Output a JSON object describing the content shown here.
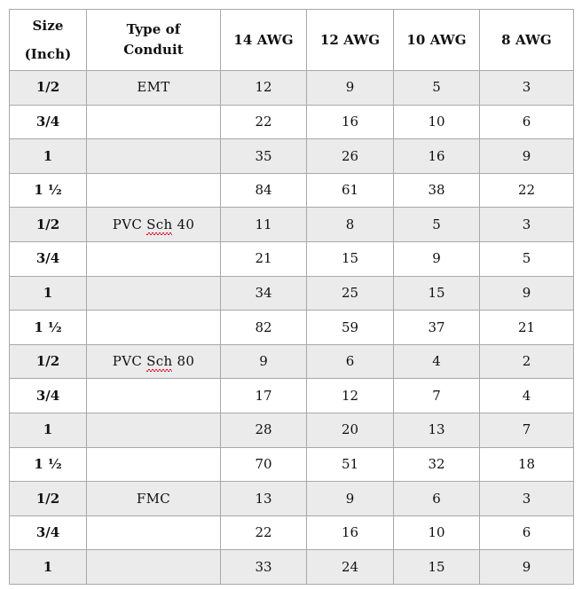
{
  "table": {
    "headers": [
      {
        "lines": [
          "Size",
          "(Inch)"
        ]
      },
      {
        "lines": [
          "Type of",
          "Conduit"
        ]
      },
      {
        "lines": [
          "14 AWG"
        ]
      },
      {
        "lines": [
          "12 AWG"
        ]
      },
      {
        "lines": [
          "10 AWG"
        ]
      },
      {
        "lines": [
          "8 AWG"
        ]
      }
    ],
    "header_labels": {
      "size": "Size",
      "size_unit": "(Inch)",
      "type_line1": "Type of",
      "type_line2": "Conduit",
      "awg14": "14 AWG",
      "awg12": "12 AWG",
      "awg10": "10 AWG",
      "awg8": "8 AWG"
    },
    "rows": [
      {
        "size": "1/2",
        "type": "EMT",
        "type_misspelled": "",
        "type_suffix": "",
        "awg14": "12",
        "awg12": "9",
        "awg10": "5",
        "awg8": "3",
        "shaded": true
      },
      {
        "size": "3/4",
        "type": "",
        "type_misspelled": "",
        "type_suffix": "",
        "awg14": "22",
        "awg12": "16",
        "awg10": "10",
        "awg8": "6",
        "shaded": false
      },
      {
        "size": "1",
        "type": "",
        "type_misspelled": "",
        "type_suffix": "",
        "awg14": "35",
        "awg12": "26",
        "awg10": "16",
        "awg8": "9",
        "shaded": true
      },
      {
        "size": "1 ½",
        "type": "",
        "type_misspelled": "",
        "type_suffix": "",
        "awg14": "84",
        "awg12": "61",
        "awg10": "38",
        "awg8": "22",
        "shaded": false
      },
      {
        "size": "1/2",
        "type": "PVC ",
        "type_misspelled": "Sch",
        "type_suffix": " 40",
        "awg14": "11",
        "awg12": "8",
        "awg10": "5",
        "awg8": "3",
        "shaded": true
      },
      {
        "size": "3/4",
        "type": "",
        "type_misspelled": "",
        "type_suffix": "",
        "awg14": "21",
        "awg12": "15",
        "awg10": "9",
        "awg8": "5",
        "shaded": false
      },
      {
        "size": "1",
        "type": "",
        "type_misspelled": "",
        "type_suffix": "",
        "awg14": "34",
        "awg12": "25",
        "awg10": "15",
        "awg8": "9",
        "shaded": true
      },
      {
        "size": "1 ½",
        "type": "",
        "type_misspelled": "",
        "type_suffix": "",
        "awg14": "82",
        "awg12": "59",
        "awg10": "37",
        "awg8": "21",
        "shaded": false
      },
      {
        "size": "1/2",
        "type": "PVC ",
        "type_misspelled": "Sch",
        "type_suffix": " 80",
        "awg14": "9",
        "awg12": "6",
        "awg10": "4",
        "awg8": "2",
        "shaded": true
      },
      {
        "size": "3/4",
        "type": "",
        "type_misspelled": "",
        "type_suffix": "",
        "awg14": "17",
        "awg12": "12",
        "awg10": "7",
        "awg8": "4",
        "shaded": false
      },
      {
        "size": "1",
        "type": "",
        "type_misspelled": "",
        "type_suffix": "",
        "awg14": "28",
        "awg12": "20",
        "awg10": "13",
        "awg8": "7",
        "shaded": true
      },
      {
        "size": "1 ½",
        "type": "",
        "type_misspelled": "",
        "type_suffix": "",
        "awg14": "70",
        "awg12": "51",
        "awg10": "32",
        "awg8": "18",
        "shaded": false
      },
      {
        "size": "1/2",
        "type": "FMC",
        "type_misspelled": "",
        "type_suffix": "",
        "awg14": "13",
        "awg12": "9",
        "awg10": "6",
        "awg8": "3",
        "shaded": true
      },
      {
        "size": "3/4",
        "type": "",
        "type_misspelled": "",
        "type_suffix": "",
        "awg14": "22",
        "awg12": "16",
        "awg10": "10",
        "awg8": "6",
        "shaded": false
      },
      {
        "size": "1",
        "type": "",
        "type_misspelled": "",
        "type_suffix": "",
        "awg14": "33",
        "awg12": "24",
        "awg10": "15",
        "awg8": "9",
        "shaded": true
      }
    ]
  },
  "colors": {
    "border": "#a8a8a8",
    "row_shaded": "#ebebeb",
    "row_plain": "#ffffff",
    "text": "#111111",
    "spellcheck_underline": "#d8112b"
  }
}
